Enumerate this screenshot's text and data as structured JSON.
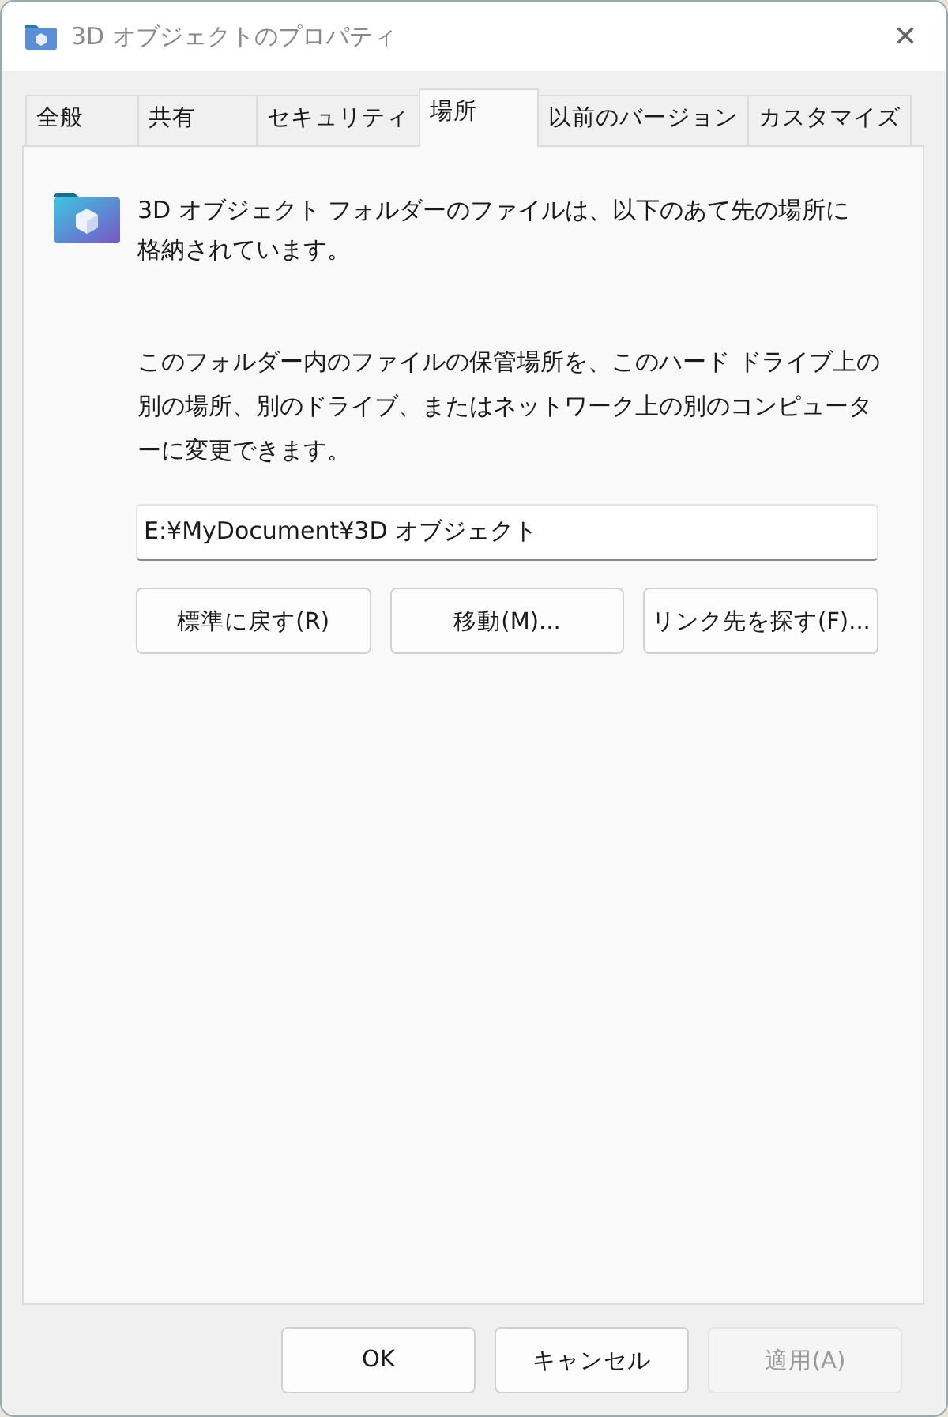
{
  "window": {
    "title": "3D オブジェクトのプロパティ",
    "close": "✕"
  },
  "tabs": [
    {
      "label": "全般",
      "selected": false
    },
    {
      "label": "共有",
      "selected": false
    },
    {
      "label": "セキュリティ",
      "selected": false
    },
    {
      "label": "場所",
      "selected": true
    },
    {
      "label": "以前のバージョン",
      "selected": false
    },
    {
      "label": "カスタマイズ",
      "selected": false
    }
  ],
  "location": {
    "intro": "3D オブジェクト フォルダーのファイルは、以下のあて先の場所に格納されています。",
    "description": "このフォルダー内のファイルの保管場所を、このハード ドライブ上の別の場所、別のドライブ、またはネットワーク上の別のコンピューターに変更できます。",
    "path": "E:¥MyDocument¥3D オブジェクト",
    "buttons": [
      {
        "label": "標準に戻す(R)",
        "disabled": false
      },
      {
        "label": "移動(M)...",
        "disabled": false
      },
      {
        "label": "リンク先を探す(F)...",
        "disabled": false
      }
    ]
  },
  "footer_buttons": [
    {
      "label": "OK",
      "disabled": false
    },
    {
      "label": "キャンセル",
      "disabled": false
    },
    {
      "label": "適用(A)",
      "disabled": true
    }
  ]
}
